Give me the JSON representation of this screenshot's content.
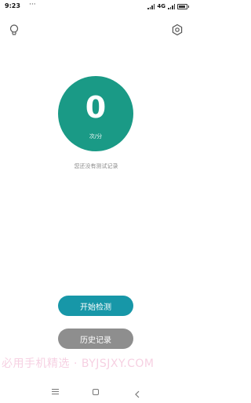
{
  "status_bar": {
    "time": "9:23",
    "dots": "···",
    "network": "4G",
    "battery_level": 0.7
  },
  "toolbar": {
    "left_icon": "lightbulb-icon",
    "right_icon": "settings-icon"
  },
  "counter": {
    "value": "0",
    "unit": "次/分",
    "color": "#1a9a86"
  },
  "empty_message": "您还没有测试记录",
  "buttons": {
    "start_label": "开始检测",
    "start_color": "#1797a8",
    "history_label": "历史记录",
    "history_color": "#8e8e8e"
  },
  "watermark": "必用手机精选 · BYJSJXY.COM",
  "nav_bar": {
    "menu_icon": "menu-icon",
    "home_icon": "home-icon",
    "back_icon": "back-icon"
  }
}
